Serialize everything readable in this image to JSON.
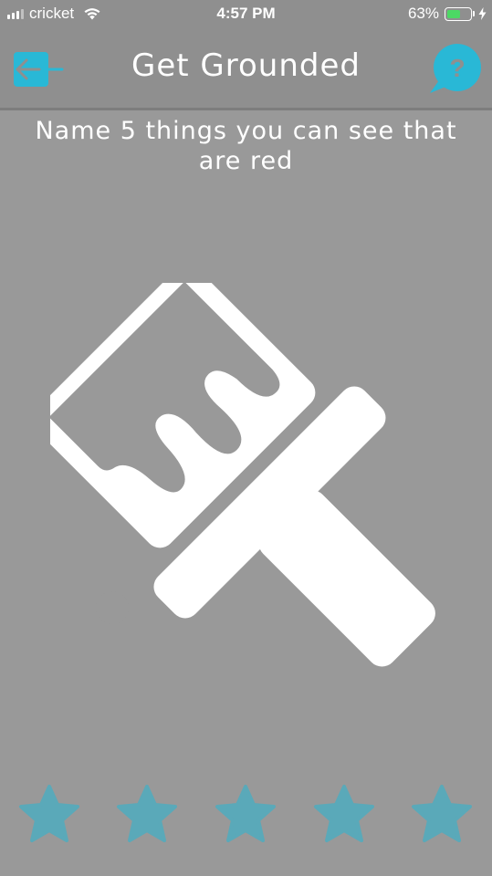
{
  "status_bar": {
    "carrier": "cricket",
    "time": "4:57 PM",
    "battery_percent": "63%",
    "battery_level": 0.63,
    "battery_fill_color": "#4cd964"
  },
  "header": {
    "title": "Get Grounded",
    "back_icon": "exit-arrow-icon",
    "help_icon": "question-bubble-icon",
    "accent_color": "#29b8d6"
  },
  "main": {
    "prompt": "Name 5 things you can see that are red",
    "illustration_icon": "paint-brush-icon",
    "rating": {
      "total": 5,
      "selected": 0,
      "star_color": "#5aa9b9",
      "icon": "star-icon"
    }
  }
}
